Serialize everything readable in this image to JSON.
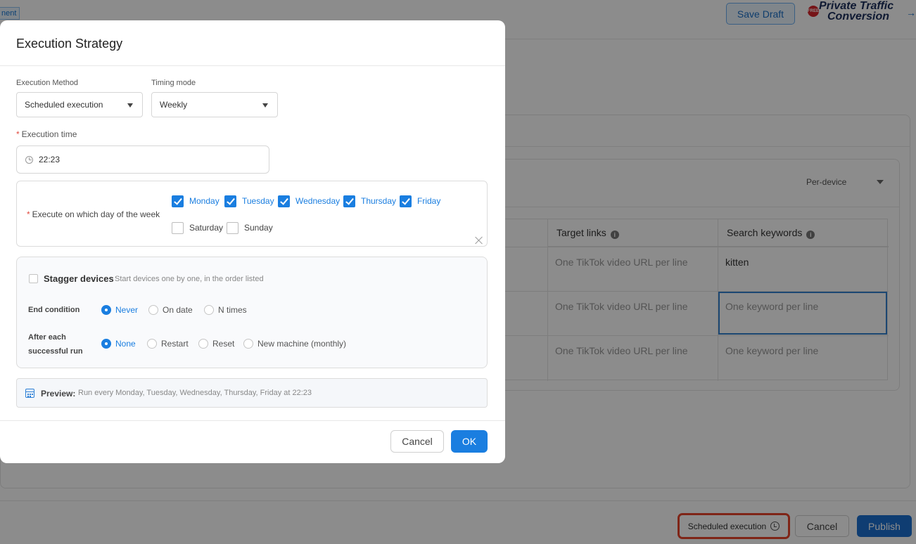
{
  "background": {
    "tag_label": "nent",
    "save_draft": "Save Draft",
    "logo": {
      "badge": "FREE",
      "line1": "Private Traffic",
      "line2": "Conversion",
      "arrow": "→"
    },
    "per_device": "Per-device",
    "table": {
      "headers": [
        "Target links",
        "Search keywords"
      ],
      "rows": [
        [
          "One TikTok video URL per line",
          "kitten"
        ],
        [
          "One TikTok video URL per line",
          "One keyword per line"
        ],
        [
          "One TikTok video URL per line",
          "One keyword per line"
        ]
      ]
    },
    "footer": {
      "scheduled_execution": "Scheduled execution",
      "cancel": "Cancel",
      "publish": "Publish"
    }
  },
  "modal": {
    "title": "Execution Strategy",
    "execution_method_label": "Execution Method",
    "execution_method_value": "Scheduled execution",
    "timing_mode_label": "Timing mode",
    "timing_mode_value": "Weekly",
    "execution_time_label": "Execution time",
    "execution_time_value": "22:23",
    "required_mark": "*",
    "days_label": "Execute on which day of the week",
    "days": [
      {
        "label": "Monday",
        "checked": true
      },
      {
        "label": "Tuesday",
        "checked": true
      },
      {
        "label": "Wednesday",
        "checked": true
      },
      {
        "label": "Thursday",
        "checked": true
      },
      {
        "label": "Friday",
        "checked": true
      },
      {
        "label": "Saturday",
        "checked": false
      },
      {
        "label": "Sunday",
        "checked": false
      }
    ],
    "stagger_title": "Stagger devices",
    "stagger_desc": "Start devices one by one, in the order listed",
    "end_condition_label": "End condition",
    "end_condition_options": [
      {
        "label": "Never",
        "selected": true
      },
      {
        "label": "On date",
        "selected": false
      },
      {
        "label": "N times",
        "selected": false
      }
    ],
    "after_run_label_line1": "After each",
    "after_run_label_line2": "successful run",
    "after_run_options": [
      {
        "label": "None",
        "selected": true
      },
      {
        "label": "Restart",
        "selected": false
      },
      {
        "label": "Reset",
        "selected": false
      },
      {
        "label": "New machine (monthly)",
        "selected": false
      }
    ],
    "preview_label": "Preview:",
    "preview_text": "Run every Monday, Tuesday, Wednesday, Thursday, Friday at 22:23",
    "cancel": "Cancel",
    "ok": "OK"
  },
  "colors": {
    "accent": "#1a7ee0",
    "publish": "#1d6fcf",
    "highlight_outline": "#e8442a",
    "overlay": "rgba(0,0,0,0.45)"
  }
}
